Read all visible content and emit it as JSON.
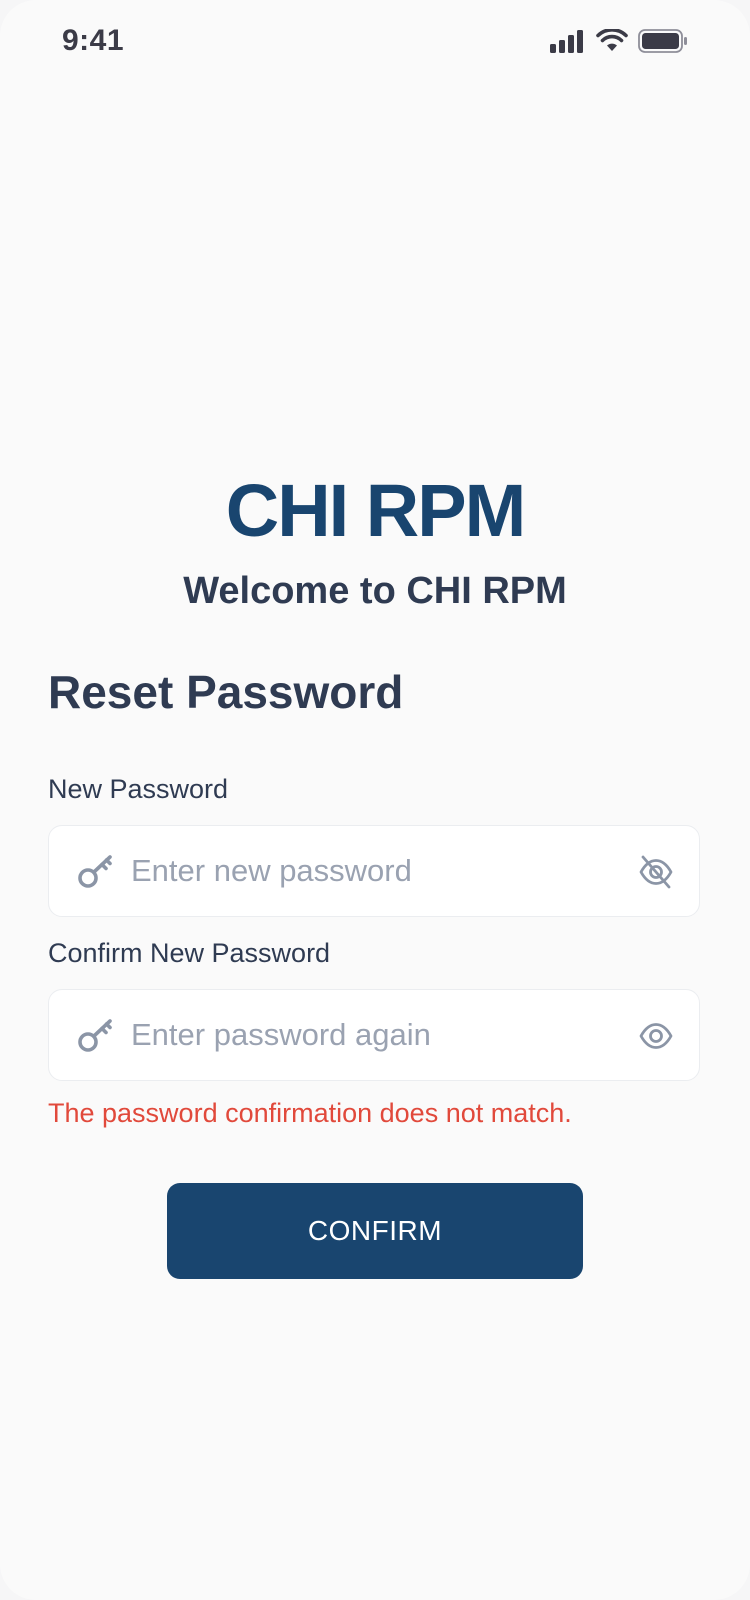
{
  "status_bar": {
    "time": "9:41",
    "icons": [
      "signal-icon",
      "wifi-icon",
      "battery-icon"
    ]
  },
  "brand": {
    "title": "CHI RPM",
    "subtitle": "Welcome to CHI RPM"
  },
  "page": {
    "heading": "Reset Password"
  },
  "form": {
    "new_password": {
      "label": "New Password",
      "placeholder": "Enter new password",
      "value": "",
      "leading_icon": "key-icon",
      "trailing_icon": "eye-off-icon"
    },
    "confirm_password": {
      "label": "Confirm New Password",
      "placeholder": "Enter password again",
      "value": "",
      "leading_icon": "key-icon",
      "trailing_icon": "eye-icon"
    },
    "error_message": "The password confirmation does not match.",
    "submit_label": "CONFIRM"
  },
  "colors": {
    "brand": "#19456f",
    "heading_text": "#2f3b52",
    "placeholder": "#9aa2b1",
    "error": "#e1493b",
    "background": "#fafafa",
    "field_background": "#ffffff"
  }
}
